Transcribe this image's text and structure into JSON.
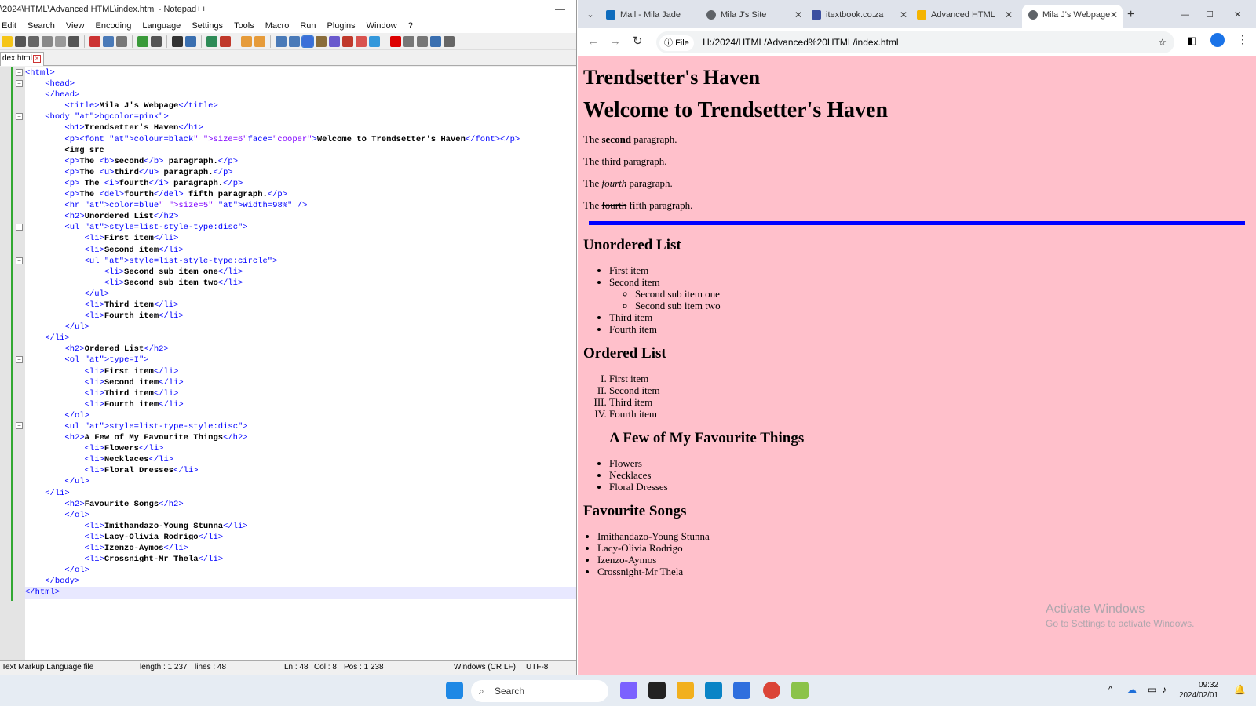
{
  "npp": {
    "title": "\\2024\\HTML\\Advanced HTML\\index.html - Notepad++",
    "minimize": "—",
    "menu": [
      "Edit",
      "Search",
      "View",
      "Encoding",
      "Language",
      "Settings",
      "Tools",
      "Macro",
      "Run",
      "Plugins",
      "Window",
      "?"
    ],
    "tab": "dex.html",
    "code": [
      "<html>",
      "    <head>",
      "    </head>",
      "        <title>Mila J's Webpage</title>",
      "    <body bgcolor=\"pink\">",
      "        <h1>Trendsetter's Haven</h1>",
      "        <p><font colour=\"black\" size=\"6\"face=\"cooper\">Welcome to Trendsetter's Haven</font></p>",
      "        <img src",
      "        <p>The <b>second</b> paragraph.</p>",
      "        <p>The <u>third</u> paragraph.</p>",
      "        <p> The <i>fourth</i> paragraph.</p>",
      "        <p>The <del>fourth</del> fifth paragraph.</p>",
      "        <hr color=\"blue\" size=\"5\" width=\"98%\" />",
      "        <h2>Unordered List</h2>",
      "        <ul style=\"list-style-type:disc\">",
      "            <li>First item</li>",
      "            <li>Second item</li>",
      "            <ul style=\"list-style-type:circle\">",
      "                <li>Second sub item one</li>",
      "                <li>Second sub item two</li>",
      "            </ul>",
      "            <li>Third item</li>",
      "            <li>Fourth item</li>",
      "        </ul>",
      "    </li>",
      "        <h2>Ordered List</h2>",
      "        <ol type=\"I\">",
      "            <li>First item</li>",
      "            <li>Second item</li>",
      "            <li>Third item</li>",
      "            <li>Fourth item</li>",
      "        </ol>",
      "        <ul style=\"list-type-style:disc\">",
      "        <h2>A Few of My Favourite Things</h2>",
      "            <li>Flowers</li>",
      "            <li>Necklaces</li>",
      "            <li>Floral Dresses</li>",
      "        </ul>",
      "    </li>",
      "        <h2>Favourite Songs</h2>",
      "        </ol>",
      "            <li>Imithandazo-Young Stunna</li>",
      "            <li>Lacy-Olivia Rodrigo</li>",
      "            <li>Izenzo-Aymos</li>",
      "            <li>Crossnight-Mr Thela</li>",
      "        </ol>",
      "    </body>",
      "</html>"
    ],
    "status": {
      "type": "Text Markup Language file",
      "length": "length : 1 237",
      "lines": "lines : 48",
      "ln": "Ln : 48",
      "col": "Col : 8",
      "pos": "Pos : 1 238",
      "eol": "Windows (CR LF)",
      "enc": "UTF-8"
    }
  },
  "chrome": {
    "tabs": [
      {
        "label": "Mail - Mila Jade",
        "color": "#0f6cbd"
      },
      {
        "label": "Mila J's Site",
        "color": "#5f6368"
      },
      {
        "label": "itextbook.co.za",
        "color": "#3c4fa0"
      },
      {
        "label": "Advanced HTML",
        "color": "#f4b400"
      },
      {
        "label": "Mila J's Webpage",
        "color": "#5f6368"
      }
    ],
    "file_chip": "File",
    "url": "H:/2024/HTML/Advanced%20HTML/index.html",
    "page": {
      "h1": "Trendsetter's Haven",
      "big": "Welcome to Trendsetter's Haven",
      "p2": {
        "pre": "The ",
        "em": "second",
        "post": " paragraph."
      },
      "p3": {
        "pre": "The ",
        "em": "third",
        "post": " paragraph."
      },
      "p4": {
        "pre": "The ",
        "em": "fourth",
        "post": " paragraph."
      },
      "p5": {
        "pre": "The ",
        "em": "fourth",
        "post": " fifth paragraph."
      },
      "ul_heading": "Unordered List",
      "ul": [
        "First item",
        "Second item"
      ],
      "ul_sub": [
        "Second sub item one",
        "Second sub item two"
      ],
      "ul_rest": [
        "Third item",
        "Fourth item"
      ],
      "ol_heading": "Ordered List",
      "ol": [
        "First item",
        "Second item",
        "Third item",
        "Fourth item"
      ],
      "fav_heading": "A Few of My Favourite Things",
      "fav": [
        "Flowers",
        "Necklaces",
        "Floral Dresses"
      ],
      "songs_heading": "Favourite Songs",
      "songs": [
        "Imithandazo-Young Stunna",
        "Lacy-Olivia Rodrigo",
        "Izenzo-Aymos",
        "Crossnight-Mr Thela"
      ]
    },
    "watermark": {
      "title": "Activate Windows",
      "sub": "Go to Settings to activate Windows."
    }
  },
  "taskbar": {
    "search": "Search",
    "time": "09:32",
    "date": "2024/02/01"
  }
}
